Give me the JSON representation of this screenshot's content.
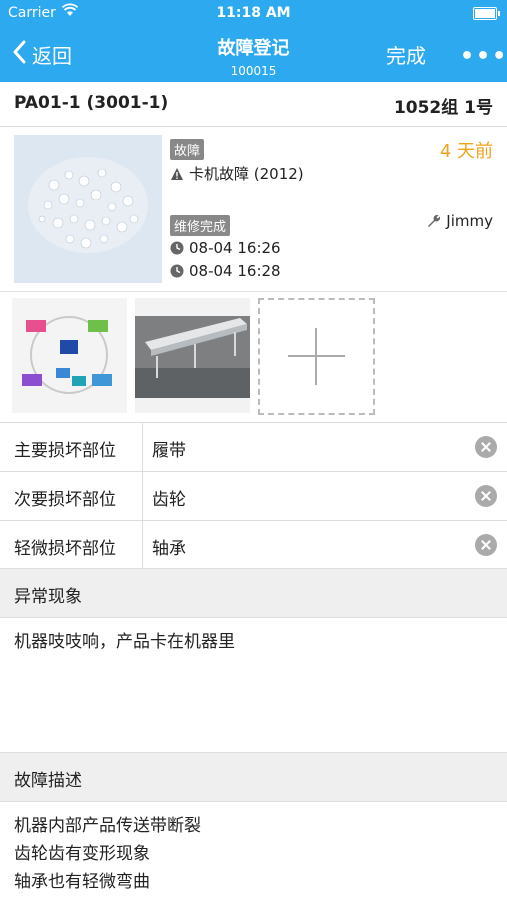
{
  "status_bar": {
    "carrier": "Carrier",
    "time": "11:18 AM"
  },
  "nav": {
    "back_label": "返回",
    "title": "故障登记",
    "subtitle": "100015",
    "done_label": "完成",
    "more_label": "•••"
  },
  "header": {
    "machine": "PA01-1 (3001-1)",
    "group": "1052组 1号"
  },
  "summary": {
    "fault_tag": "故障",
    "fault_text": "卡机故障 (2012)",
    "time_ago": "4 天前",
    "repair_tag": "维修完成",
    "technician": "Jimmy",
    "start_time": "08-04 16:26",
    "end_time": "08-04 16:28"
  },
  "damage": [
    {
      "label": "主要损坏部位",
      "value": "履带"
    },
    {
      "label": "次要损坏部位",
      "value": "齿轮"
    },
    {
      "label": "轻微损坏部位",
      "value": "轴承"
    }
  ],
  "abnormal": {
    "title": "异常现象",
    "text": "机器吱吱响，产品卡在机器里"
  },
  "description": {
    "title": "故障描述",
    "lines": [
      "机器内部产品传送带断裂",
      "齿轮齿有变形现象",
      "轴承也有轻微弯曲"
    ]
  },
  "colors": {
    "nav": "#2da9f0",
    "accent": "#f0a31a",
    "tag": "#888888"
  }
}
